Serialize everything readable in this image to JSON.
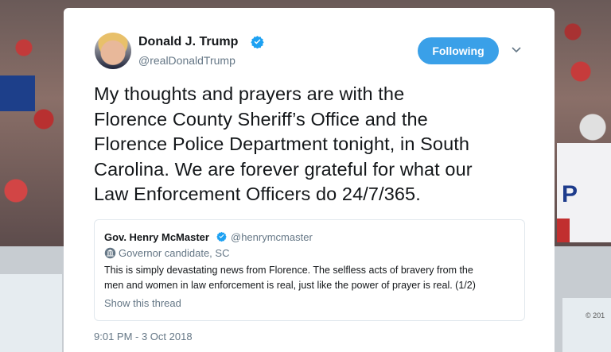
{
  "background": {
    "right_sign_letter": "P",
    "copyright": "© 201"
  },
  "tweet": {
    "author": {
      "name": "Donald J. Trump",
      "handle": "@realDonaldTrump",
      "verified": true
    },
    "follow_button_label": "Following",
    "text_lines": [
      "My thoughts and prayers are with the",
      "Florence County Sheriff’s Office and the",
      "Florence Police Department tonight, in South",
      "Carolina. We are forever grateful for what our",
      "Law Enforcement Officers do 24/7/365."
    ],
    "quoted": {
      "name": "Gov. Henry McMaster",
      "handle": "@henrymcmaster",
      "verified": true,
      "label": "Governor candidate, SC",
      "text_lines": [
        "This is simply devastating news from Florence. The selfless acts of bravery from the",
        "men and women in law enforcement is real, just like the power of prayer is real. (1/2)"
      ],
      "show_thread": "Show this thread"
    },
    "timestamp": "9:01 PM - 3 Oct 2018"
  },
  "colors": {
    "accent": "#3aa0e8",
    "verified": "#1da1f2",
    "text_primary": "#14171a",
    "text_secondary": "#657786"
  },
  "icons": [
    "verified-badge-icon",
    "chevron-down-icon",
    "government-building-icon",
    "avatar"
  ]
}
